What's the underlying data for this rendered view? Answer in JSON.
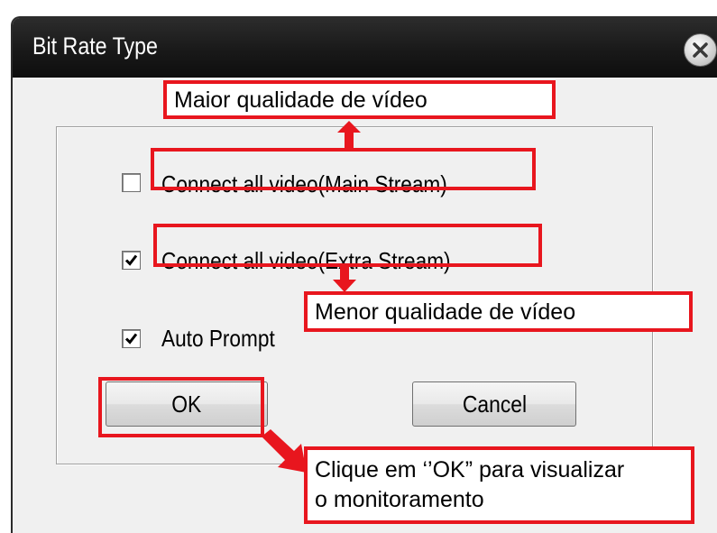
{
  "dialog": {
    "title": "Bit Rate Type",
    "close_icon": "close-icon"
  },
  "options": [
    {
      "label": "Connect all video(Main Stream)",
      "checked": false
    },
    {
      "label": "Connect all video(Extra Stream)",
      "checked": true
    },
    {
      "label": "Auto Prompt",
      "checked": true
    }
  ],
  "buttons": {
    "ok_label": "OK",
    "cancel_label": "Cancel"
  },
  "annotations": {
    "main_stream_note": "Maior qualidade de vídeo",
    "extra_stream_note": "Menor qualidade de vídeo",
    "ok_note_line1": "Clique em ‘’OK” para visualizar",
    "ok_note_line2": "o monitoramento"
  },
  "colors": {
    "annotation": "#e8161e",
    "titlebar": "#1a1a1a",
    "client": "#f0f0f0"
  }
}
